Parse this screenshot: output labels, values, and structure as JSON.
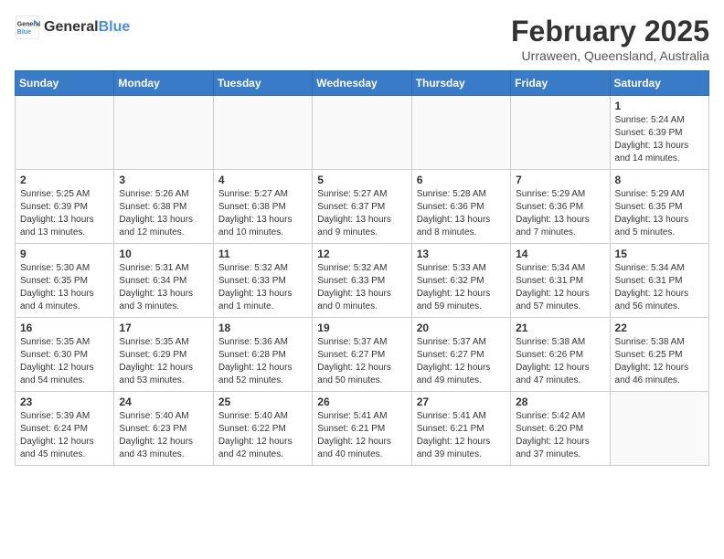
{
  "header": {
    "logo_general": "General",
    "logo_blue": "Blue",
    "month_year": "February 2025",
    "location": "Urraween, Queensland, Australia"
  },
  "days_of_week": [
    "Sunday",
    "Monday",
    "Tuesday",
    "Wednesday",
    "Thursday",
    "Friday",
    "Saturday"
  ],
  "weeks": [
    [
      {
        "day": "",
        "info": ""
      },
      {
        "day": "",
        "info": ""
      },
      {
        "day": "",
        "info": ""
      },
      {
        "day": "",
        "info": ""
      },
      {
        "day": "",
        "info": ""
      },
      {
        "day": "",
        "info": ""
      },
      {
        "day": "1",
        "info": "Sunrise: 5:24 AM\nSunset: 6:39 PM\nDaylight: 13 hours\nand 14 minutes."
      }
    ],
    [
      {
        "day": "2",
        "info": "Sunrise: 5:25 AM\nSunset: 6:39 PM\nDaylight: 13 hours\nand 13 minutes."
      },
      {
        "day": "3",
        "info": "Sunrise: 5:26 AM\nSunset: 6:38 PM\nDaylight: 13 hours\nand 12 minutes."
      },
      {
        "day": "4",
        "info": "Sunrise: 5:27 AM\nSunset: 6:38 PM\nDaylight: 13 hours\nand 10 minutes."
      },
      {
        "day": "5",
        "info": "Sunrise: 5:27 AM\nSunset: 6:37 PM\nDaylight: 13 hours\nand 9 minutes."
      },
      {
        "day": "6",
        "info": "Sunrise: 5:28 AM\nSunset: 6:36 PM\nDaylight: 13 hours\nand 8 minutes."
      },
      {
        "day": "7",
        "info": "Sunrise: 5:29 AM\nSunset: 6:36 PM\nDaylight: 13 hours\nand 7 minutes."
      },
      {
        "day": "8",
        "info": "Sunrise: 5:29 AM\nSunset: 6:35 PM\nDaylight: 13 hours\nand 5 minutes."
      }
    ],
    [
      {
        "day": "9",
        "info": "Sunrise: 5:30 AM\nSunset: 6:35 PM\nDaylight: 13 hours\nand 4 minutes."
      },
      {
        "day": "10",
        "info": "Sunrise: 5:31 AM\nSunset: 6:34 PM\nDaylight: 13 hours\nand 3 minutes."
      },
      {
        "day": "11",
        "info": "Sunrise: 5:32 AM\nSunset: 6:33 PM\nDaylight: 13 hours\nand 1 minute."
      },
      {
        "day": "12",
        "info": "Sunrise: 5:32 AM\nSunset: 6:33 PM\nDaylight: 13 hours\nand 0 minutes."
      },
      {
        "day": "13",
        "info": "Sunrise: 5:33 AM\nSunset: 6:32 PM\nDaylight: 12 hours\nand 59 minutes."
      },
      {
        "day": "14",
        "info": "Sunrise: 5:34 AM\nSunset: 6:31 PM\nDaylight: 12 hours\nand 57 minutes."
      },
      {
        "day": "15",
        "info": "Sunrise: 5:34 AM\nSunset: 6:31 PM\nDaylight: 12 hours\nand 56 minutes."
      }
    ],
    [
      {
        "day": "16",
        "info": "Sunrise: 5:35 AM\nSunset: 6:30 PM\nDaylight: 12 hours\nand 54 minutes."
      },
      {
        "day": "17",
        "info": "Sunrise: 5:35 AM\nSunset: 6:29 PM\nDaylight: 12 hours\nand 53 minutes."
      },
      {
        "day": "18",
        "info": "Sunrise: 5:36 AM\nSunset: 6:28 PM\nDaylight: 12 hours\nand 52 minutes."
      },
      {
        "day": "19",
        "info": "Sunrise: 5:37 AM\nSunset: 6:27 PM\nDaylight: 12 hours\nand 50 minutes."
      },
      {
        "day": "20",
        "info": "Sunrise: 5:37 AM\nSunset: 6:27 PM\nDaylight: 12 hours\nand 49 minutes."
      },
      {
        "day": "21",
        "info": "Sunrise: 5:38 AM\nSunset: 6:26 PM\nDaylight: 12 hours\nand 47 minutes."
      },
      {
        "day": "22",
        "info": "Sunrise: 5:38 AM\nSunset: 6:25 PM\nDaylight: 12 hours\nand 46 minutes."
      }
    ],
    [
      {
        "day": "23",
        "info": "Sunrise: 5:39 AM\nSunset: 6:24 PM\nDaylight: 12 hours\nand 45 minutes."
      },
      {
        "day": "24",
        "info": "Sunrise: 5:40 AM\nSunset: 6:23 PM\nDaylight: 12 hours\nand 43 minutes."
      },
      {
        "day": "25",
        "info": "Sunrise: 5:40 AM\nSunset: 6:22 PM\nDaylight: 12 hours\nand 42 minutes."
      },
      {
        "day": "26",
        "info": "Sunrise: 5:41 AM\nSunset: 6:21 PM\nDaylight: 12 hours\nand 40 minutes."
      },
      {
        "day": "27",
        "info": "Sunrise: 5:41 AM\nSunset: 6:21 PM\nDaylight: 12 hours\nand 39 minutes."
      },
      {
        "day": "28",
        "info": "Sunrise: 5:42 AM\nSunset: 6:20 PM\nDaylight: 12 hours\nand 37 minutes."
      },
      {
        "day": "",
        "info": ""
      }
    ]
  ]
}
